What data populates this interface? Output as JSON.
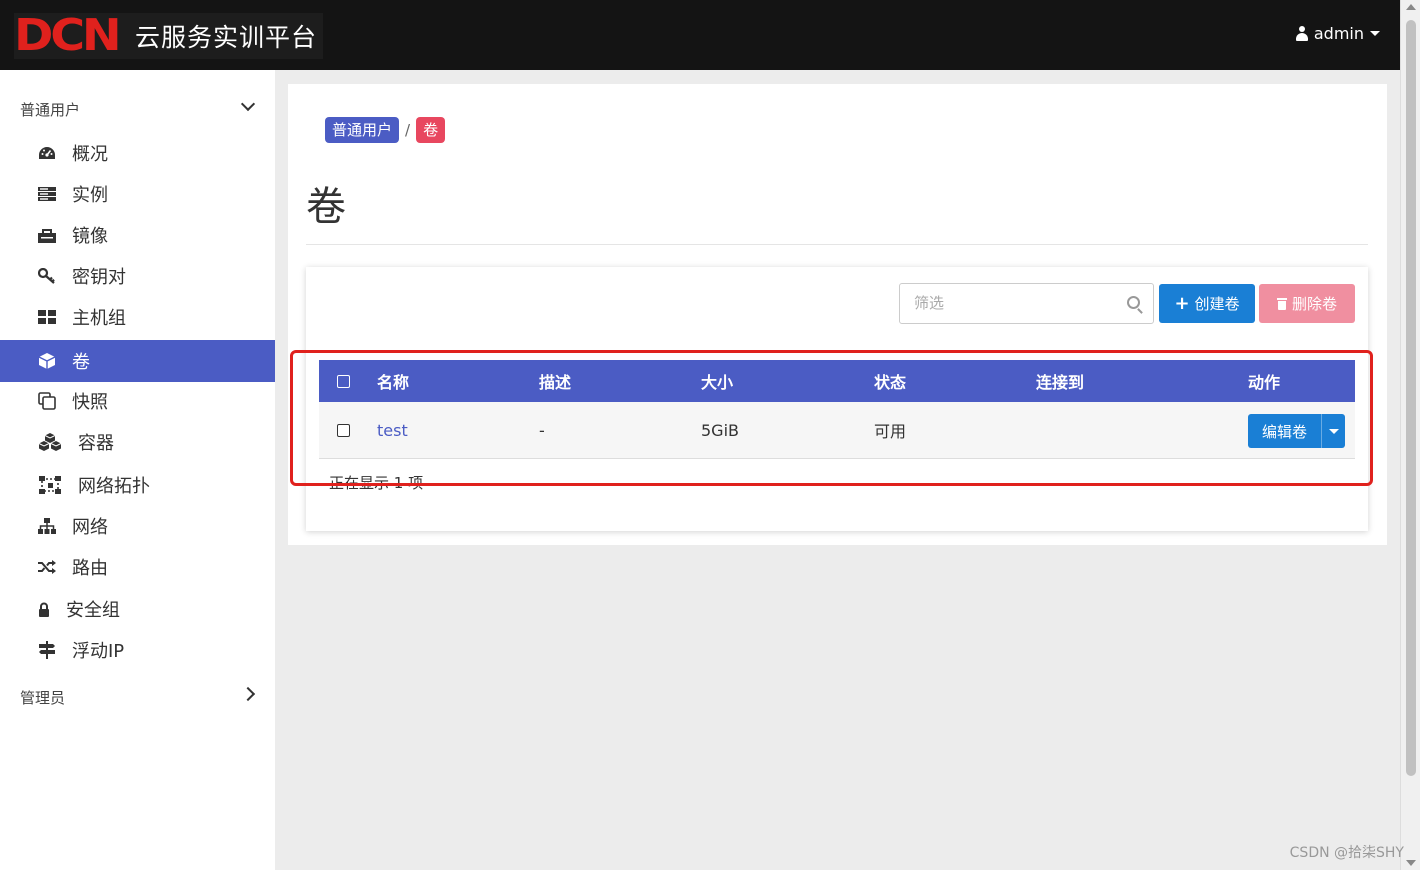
{
  "navbar": {
    "logo_text": "DCN",
    "title": "云服务实训平台",
    "user": "admin"
  },
  "sidebar": {
    "section_user": "普通用户",
    "section_admin": "管理员",
    "items": [
      {
        "label": "概况",
        "icon": "dashboard-icon"
      },
      {
        "label": "实例",
        "icon": "server-icon"
      },
      {
        "label": "镜像",
        "icon": "image-icon"
      },
      {
        "label": "密钥对",
        "icon": "key-icon"
      },
      {
        "label": "主机组",
        "icon": "grid-icon"
      },
      {
        "label": "卷",
        "icon": "cube-icon",
        "active": true
      },
      {
        "label": "快照",
        "icon": "copy-icon"
      },
      {
        "label": "容器",
        "icon": "cubes-icon"
      },
      {
        "label": "网络拓扑",
        "icon": "topology-icon"
      },
      {
        "label": "网络",
        "icon": "sitemap-icon"
      },
      {
        "label": "路由",
        "icon": "random-icon"
      },
      {
        "label": "安全组",
        "icon": "lock-icon"
      },
      {
        "label": "浮动IP",
        "icon": "signpost-icon"
      }
    ]
  },
  "breadcrumb": {
    "items": [
      "普通用户",
      "卷"
    ],
    "separator": "/"
  },
  "page": {
    "title": "卷"
  },
  "toolbar": {
    "filter_placeholder": "筛选",
    "create_label": "创建卷",
    "delete_label": "删除卷"
  },
  "table": {
    "columns": [
      "名称",
      "描述",
      "大小",
      "状态",
      "连接到",
      "动作"
    ],
    "rows": [
      {
        "name": "test",
        "description": "-",
        "size": "5GiB",
        "status": "可用",
        "attached_to": "",
        "action": "编辑卷"
      }
    ],
    "footer": "正在显示 1 项"
  },
  "watermark": "CSDN @拾柒SHY",
  "colors": {
    "accent": "#4b5cc4",
    "primary_button": "#1a7fd5",
    "danger_button_disabled": "#f08fa0",
    "logo_red": "#e0211d",
    "highlight_border": "#e0211d"
  }
}
